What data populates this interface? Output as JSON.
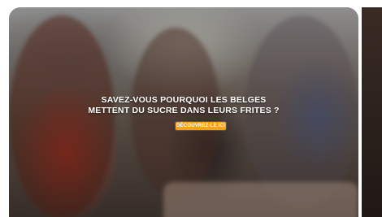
{
  "hero": {
    "title_line_1": "SAVEZ-VOUS POURQUOI LES BELGES",
    "title_line_2": "METTENT DU SUCRE DANS LEURS FRITES ?",
    "cta_label": "DÉCOUVREZ-LE ICI"
  },
  "colors": {
    "cta_background": "#f5a21c",
    "title_text": "#ffffff"
  }
}
